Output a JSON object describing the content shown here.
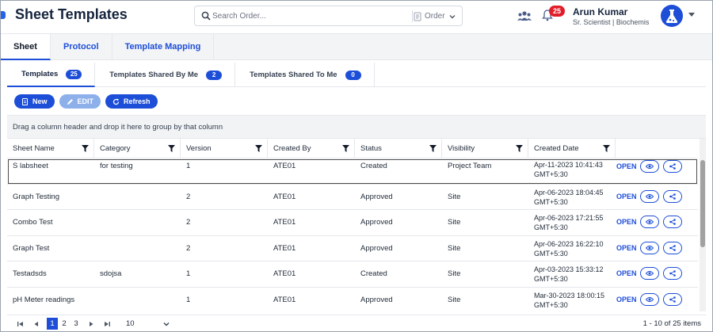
{
  "header": {
    "title": "Sheet Templates",
    "search_placeholder": "Search Order...",
    "order_select": "Order",
    "notification_count": "25",
    "user_name": "Arun Kumar",
    "user_role": "Sr. Scientist | Biochemis"
  },
  "main_tabs": [
    "Sheet",
    "Protocol",
    "Template Mapping"
  ],
  "sub_tabs": [
    {
      "label": "Templates",
      "count": "25"
    },
    {
      "label": "Templates Shared By Me",
      "count": "2"
    },
    {
      "label": "Templates Shared To Me",
      "count": "0"
    }
  ],
  "toolbar": {
    "new_label": "New",
    "edit_label": "EDIT",
    "refresh_label": "Refresh"
  },
  "group_hint": "Drag a column header and drop it here to group by that column",
  "columns": [
    "Sheet Name",
    "Category",
    "Version",
    "Created By",
    "Status",
    "Visibility",
    "Created Date"
  ],
  "rows": [
    {
      "name": "S labsheet",
      "category": "for testing",
      "version": "1",
      "created_by": "ATE01",
      "status": "Created",
      "visibility": "Project Team",
      "created_date": "Apr-11-2023 10:41:43 GMT+5:30",
      "open": "OPEN"
    },
    {
      "name": "Graph Testing",
      "category": "",
      "version": "2",
      "created_by": "ATE01",
      "status": "Approved",
      "visibility": "Site",
      "created_date": "Apr-06-2023 18:04:45 GMT+5:30",
      "open": "OPEN"
    },
    {
      "name": "Combo Test",
      "category": "",
      "version": "2",
      "created_by": "ATE01",
      "status": "Approved",
      "visibility": "Site",
      "created_date": "Apr-06-2023 17:21:55 GMT+5:30",
      "open": "OPEN"
    },
    {
      "name": "Graph Test",
      "category": "",
      "version": "2",
      "created_by": "ATE01",
      "status": "Approved",
      "visibility": "Site",
      "created_date": "Apr-06-2023 16:22:10 GMT+5:30",
      "open": "OPEN"
    },
    {
      "name": "Testadsds",
      "category": "sdojsa",
      "version": "1",
      "created_by": "ATE01",
      "status": "Created",
      "visibility": "Site",
      "created_date": "Apr-03-2023 15:33:12 GMT+5:30",
      "open": "OPEN"
    },
    {
      "name": "pH Meter readings",
      "category": "",
      "version": "1",
      "created_by": "ATE01",
      "status": "Approved",
      "visibility": "Site",
      "created_date": "Mar-30-2023 18:00:15 GMT+5:30",
      "open": "OPEN"
    }
  ],
  "pager": {
    "pages": [
      "1",
      "2",
      "3"
    ],
    "current_page": "1",
    "page_size": "10",
    "info": "1 - 10 of 25 items"
  },
  "colors": {
    "accent": "#1d4ed8",
    "badge_red": "#e11d2a",
    "title": "#16243d"
  },
  "icons": [
    "search-icon",
    "order-icon",
    "team-icon",
    "bell-icon",
    "avatar",
    "filter-icon",
    "eye-icon",
    "share-icon"
  ]
}
